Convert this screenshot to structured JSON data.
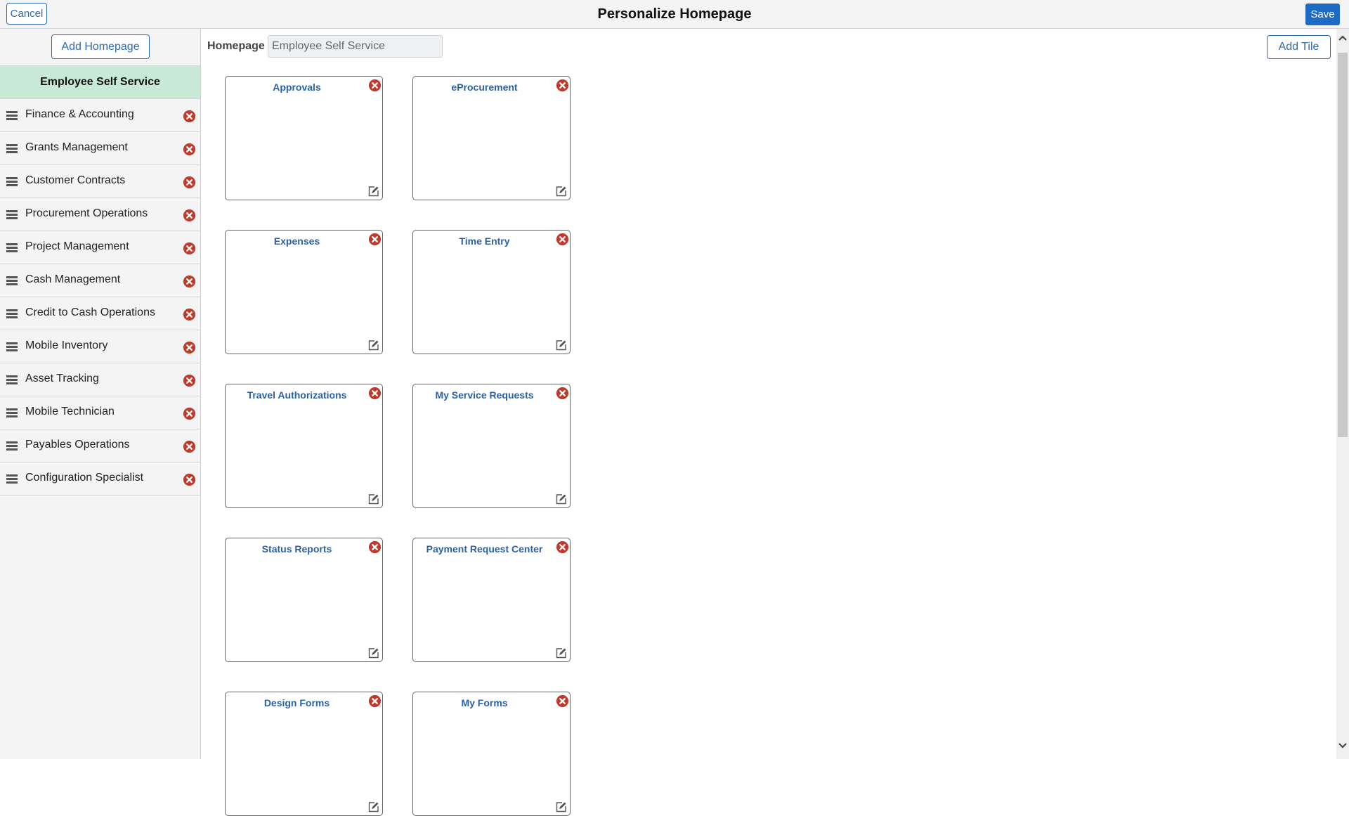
{
  "header": {
    "title": "Personalize Homepage",
    "cancel_label": "Cancel",
    "save_label": "Save"
  },
  "sidebar": {
    "add_homepage_label": "Add Homepage",
    "selected_homepage": "Employee Self Service",
    "homepages": [
      {
        "label": "Finance & Accounting"
      },
      {
        "label": "Grants Management"
      },
      {
        "label": "Customer Contracts"
      },
      {
        "label": "Procurement Operations"
      },
      {
        "label": "Project Management"
      },
      {
        "label": "Cash Management"
      },
      {
        "label": "Credit to Cash Operations"
      },
      {
        "label": "Mobile Inventory"
      },
      {
        "label": "Asset Tracking"
      },
      {
        "label": "Mobile Technician"
      },
      {
        "label": "Payables Operations"
      },
      {
        "label": "Configuration Specialist"
      }
    ]
  },
  "main": {
    "homepage_label": "Homepage",
    "homepage_value": "Employee Self Service",
    "add_tile_label": "Add Tile",
    "tiles": [
      {
        "title": "Approvals"
      },
      {
        "title": "eProcurement"
      },
      {
        "title": "Expenses"
      },
      {
        "title": "Time Entry"
      },
      {
        "title": "Travel Authorizations"
      },
      {
        "title": "My Service Requests"
      },
      {
        "title": "Status Reports"
      },
      {
        "title": "Payment Request Center"
      },
      {
        "title": "Design Forms"
      },
      {
        "title": "My Forms"
      }
    ]
  },
  "icons": {
    "drag": "drag-handle-icon",
    "delete": "remove-circle-icon",
    "edit": "edit-icon",
    "scroll_up": "chevron-up-icon",
    "scroll_down": "chevron-down-icon"
  },
  "colors": {
    "accent": "#1e6bc6",
    "selected_row": "#c8e9d6",
    "delete": "#c0392b",
    "tile_title": "#2a62a4"
  }
}
